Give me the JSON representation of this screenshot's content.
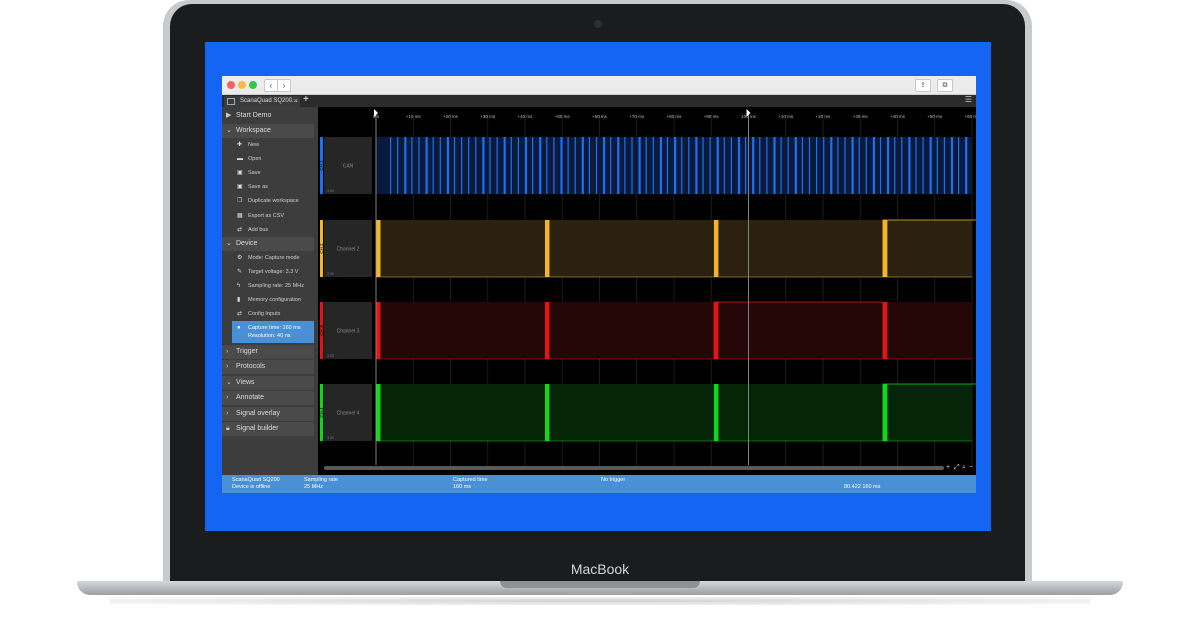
{
  "device": {
    "brand": "MacBook"
  },
  "browser": {
    "nav_back": "‹",
    "nav_forward": "›",
    "share_icon": "⇪",
    "tabs_icon": "⧉",
    "tab_title": "ScanaQuad SQ200...",
    "tab_close": "×",
    "tab_add": "+",
    "menu_icon": "☰"
  },
  "sidebar": {
    "start_demo": "Start Demo",
    "workspace": {
      "title": "Workspace",
      "items": [
        "New",
        "Open",
        "Save",
        "Save as",
        "Duplicate workspace",
        "Export as CSV",
        "Add bus"
      ]
    },
    "device": {
      "title": "Device",
      "items": [
        "Mode: Capture mode",
        "Target voltage: 3.3 V",
        "Sampling rate: 25 MHz",
        "Memory configuration",
        "Config Inputs"
      ],
      "info_line1": "Capture time: 160 ms",
      "info_line2": "Resolution: 40 ns"
    },
    "sections": [
      "Trigger",
      "Protocols",
      "Views",
      "Annotate",
      "Signal overlay",
      "Signal builder"
    ]
  },
  "plot": {
    "ruler_top": [
      "0 s",
      "+10 ms",
      "+20 ms",
      "+30 ms",
      "+40 ms",
      "+50 ms",
      "+60 ms",
      "+70 ms",
      "+80 ms",
      "+90 ms",
      "100 ms",
      "+10 ms",
      "+20 ms",
      "+30 ms",
      "+40 ms",
      "+50 ms",
      "+60 ms"
    ],
    "channels": [
      {
        "id": "CH 1",
        "name": "CAN",
        "color": "#1e6ff5",
        "fill": "#0a1a3a",
        "type": "dense"
      },
      {
        "id": "CH 2",
        "name": "Channel 2",
        "color": "#f5b52a",
        "fill": "#2a2110",
        "type": "pulse"
      },
      {
        "id": "CH 3",
        "name": "Channel 3",
        "color": "#e01515",
        "fill": "#260707",
        "type": "pulse"
      },
      {
        "id": "CH 4",
        "name": "Channel 4",
        "color": "#12d61a",
        "fill": "#052408",
        "type": "pulse"
      }
    ],
    "channel_small": "3.3V",
    "pulse_positions_ms": [
      0,
      28,
      56,
      84,
      112,
      140
    ],
    "highlight_ranges_ms": [
      [
        84,
        112
      ],
      [
        56,
        84
      ],
      [
        84,
        112
      ]
    ],
    "cursor_ms": 100,
    "span_ms": 160
  },
  "status": {
    "device_name": "ScanaQuad SQ200",
    "device_state": "Device is offline",
    "sampling_label": "Sampling rate",
    "sampling_value": "25 MHz",
    "captured_label": "Captured time",
    "captured_value": "160 ms",
    "trigger": "No trigger",
    "cursor_readout": "80.422 160 ms"
  }
}
